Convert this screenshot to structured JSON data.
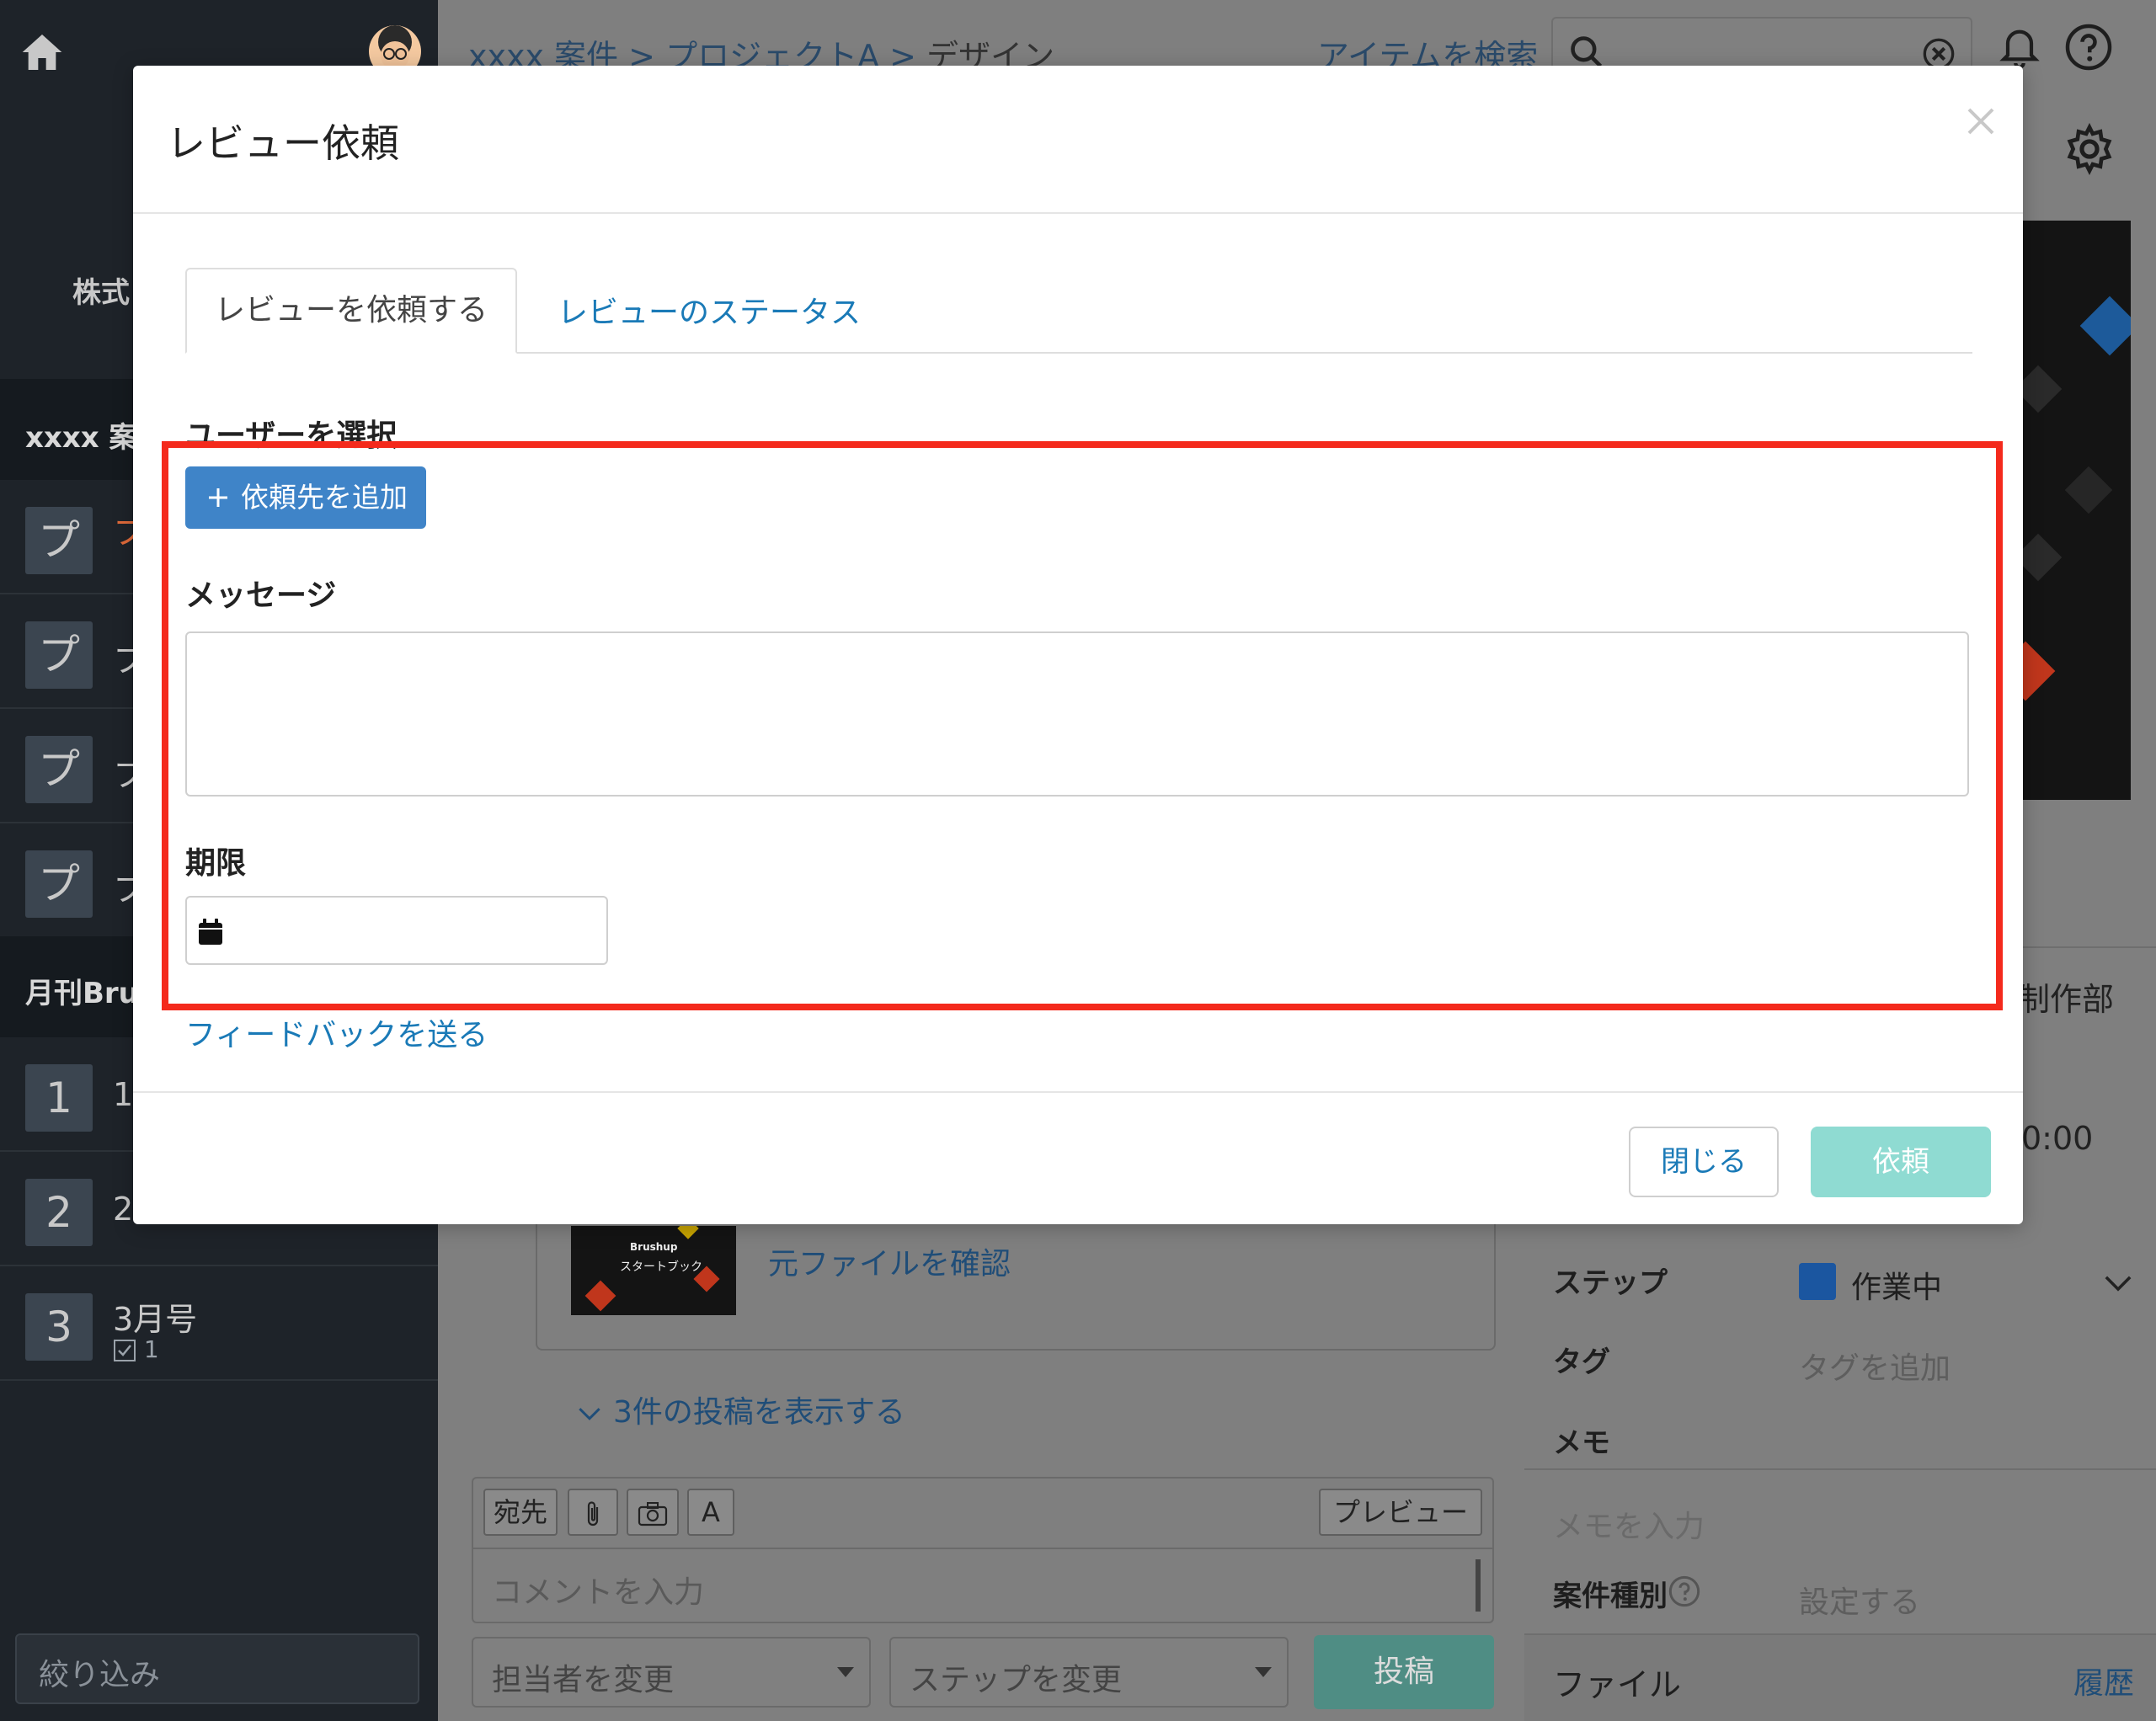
{
  "sidebar": {
    "org_name": "株式",
    "sections": [
      {
        "title": "xxxx 案"
      },
      {
        "title": "月刊Bru"
      }
    ],
    "project_items": [
      {
        "badge": "プ",
        "label": "フ"
      },
      {
        "badge": "プ",
        "label": "フ"
      },
      {
        "badge": "プ",
        "label": "フ"
      },
      {
        "badge": "プ",
        "label": "フ"
      }
    ],
    "issue_items": [
      {
        "badge": "1",
        "label": "1"
      },
      {
        "badge": "2",
        "label": "2"
      },
      {
        "badge": "3",
        "label": "3月号",
        "count": "1"
      }
    ],
    "filter_placeholder": "絞り込み"
  },
  "header": {
    "breadcrumb": [
      {
        "label": "xxxx 案件"
      },
      {
        "label": "プロジェクトA"
      },
      {
        "label": "デザイン"
      }
    ],
    "separator": ">",
    "item_search_label": "アイテムを検索"
  },
  "right_panel": {
    "dept_text": "制作部",
    "time_text": "0:00",
    "step_label": "ステップ",
    "step_value": "作業中",
    "tag_label": "タグ",
    "tag_placeholder": "タグを追加",
    "memo_label": "メモ",
    "memo_placeholder": "メモを入力",
    "case_type_label": "案件種別",
    "case_type_value": "設定する",
    "file_title": "ファイル",
    "history_link": "履歴"
  },
  "main": {
    "thumb_brand": "Brushup",
    "thumb_title": "スタートブック",
    "source_file_link": "元ファイルを確認",
    "show_posts": "3件の投稿を表示する",
    "toolbar": {
      "to_label": "宛先",
      "font_label": "A",
      "preview_label": "プレビュー"
    },
    "comment_placeholder": "コメントを入力",
    "assignee_select": "担当者を変更",
    "step_select": "ステップを変更",
    "post_button": "投稿"
  },
  "modal": {
    "title": "レビュー依頼",
    "tabs": [
      {
        "label": "レビューを依頼する",
        "active": true
      },
      {
        "label": "レビューのステータス",
        "active": false
      }
    ],
    "select_user_label": "ユーザーを選択",
    "add_requestee_button": "依頼先を追加",
    "message_label": "メッセージ",
    "message_value": "",
    "deadline_label": "期限",
    "deadline_value": "",
    "feedback_link": "フィードバックを送る",
    "close_button": "閉じる",
    "request_button": "依頼"
  },
  "colors": {
    "highlight": "#f42a1c",
    "primary_button": "#3f84c8",
    "request_button_disabled": "#8fdbd2",
    "link": "#1a7ab7",
    "step_status": "#1b56a0"
  }
}
